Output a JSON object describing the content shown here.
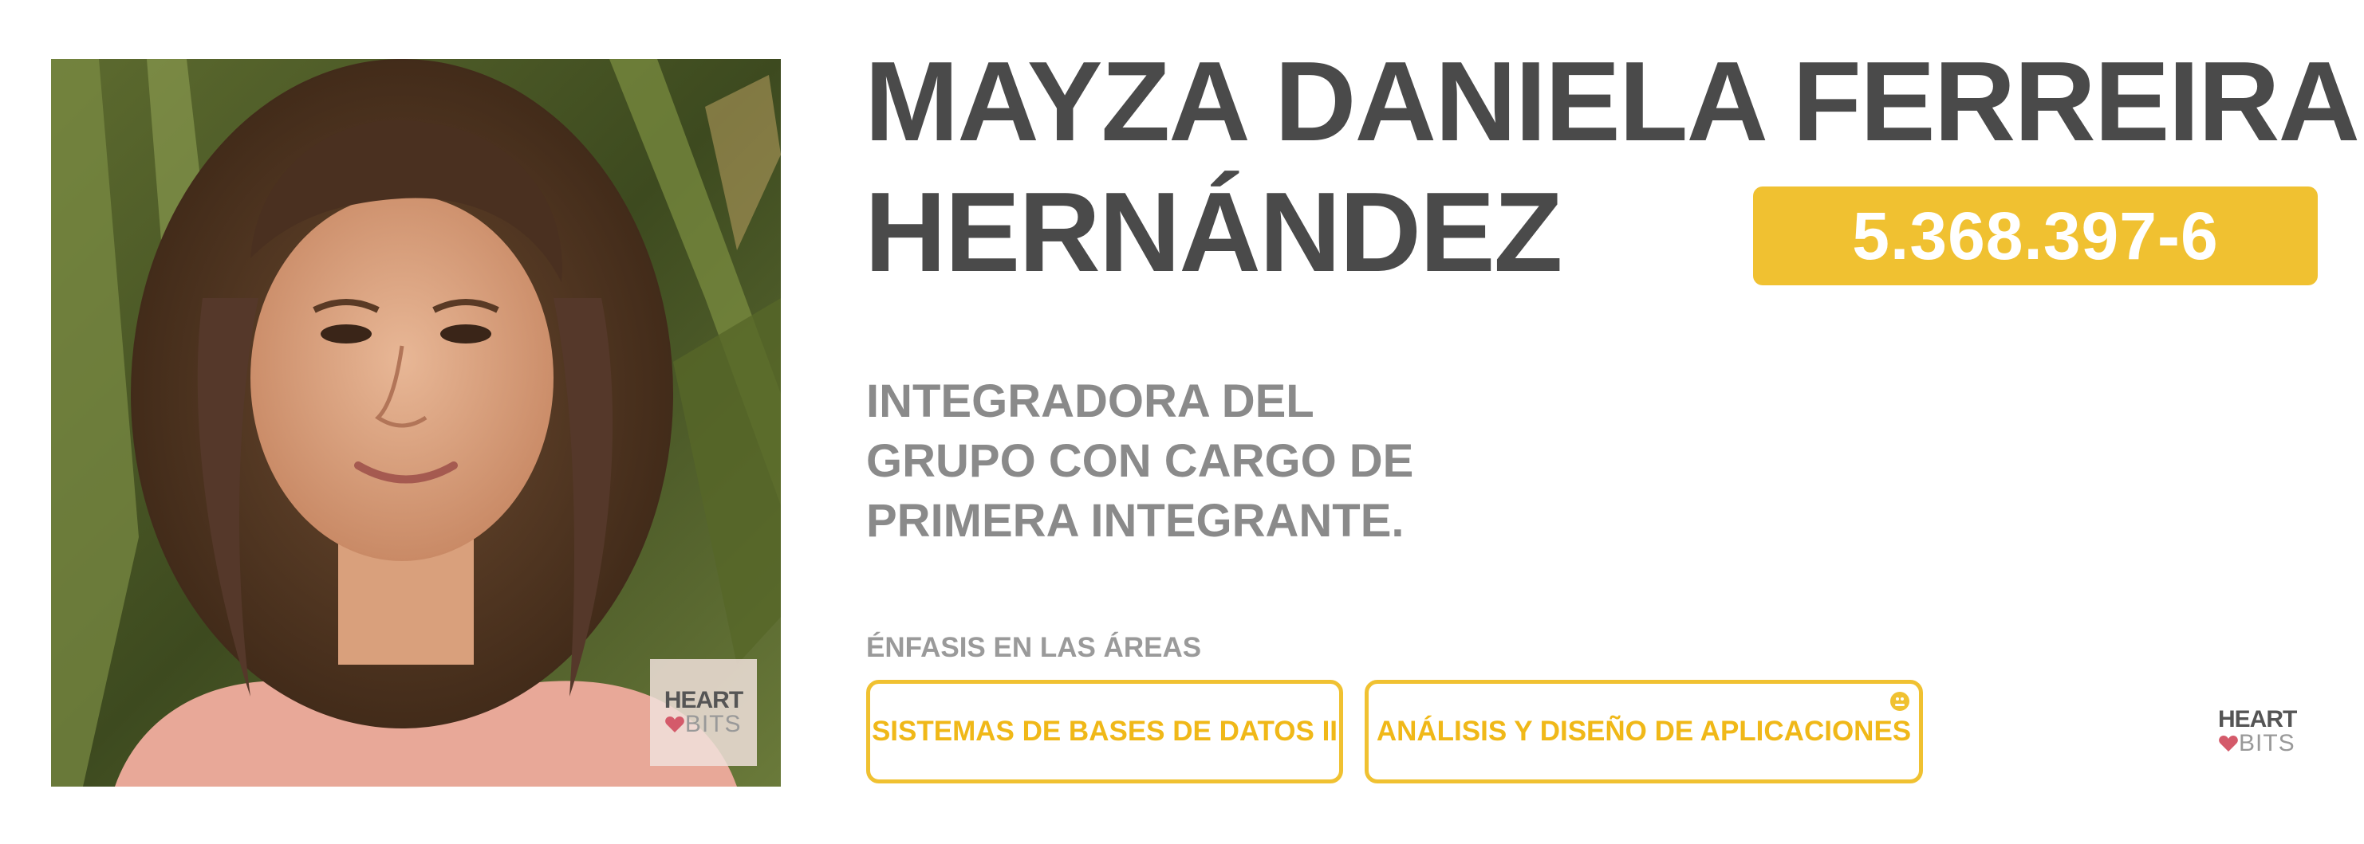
{
  "person": {
    "name_line1": "MAYZA DANIELA FERREIRA",
    "name_line2": "HERNÁNDEZ",
    "id_number": "5.368.397-6",
    "role_lines": [
      "INTEGRADORA DEL",
      "GRUPO CON CARGO DE",
      "PRIMERA INTEGRANTE."
    ],
    "photo_alt_icon": "portrait-photo"
  },
  "areas": {
    "heading": "ÉNFASIS EN LAS ÁREAS",
    "items": [
      {
        "label": "SISTEMAS DE BASES DE DATOS II"
      },
      {
        "label": "ANÁLISIS Y DISEÑO DE APLICACIONES",
        "icon": "face-icon"
      }
    ]
  },
  "logo": {
    "top": "HEART",
    "bottom": "BITS",
    "icon": "heart-icon"
  },
  "colors": {
    "accent": "#f0c131",
    "name_text": "#4a4a4a",
    "role_text": "#8a8a8a",
    "muted_text": "#9a9a9a"
  }
}
